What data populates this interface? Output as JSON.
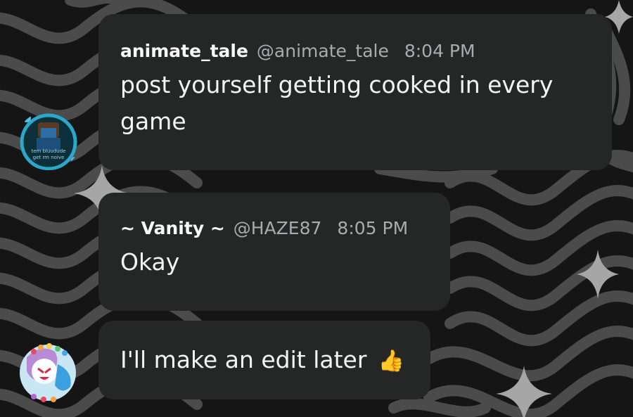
{
  "messages": [
    {
      "display_name": "animate_tale",
      "handle": "@animate_tale",
      "time": "8:04 PM",
      "text_line1": "post yourself getting cooked in every",
      "text_line2": "game",
      "avatar_caption1": "tem bluudude",
      "avatar_caption2": "get rm noive"
    },
    {
      "display_name": "~ Vanity ~",
      "handle": "@HAZE87",
      "time": "8:05 PM",
      "text": "Okay"
    },
    {
      "text": "I'll make an edit later",
      "emoji": "👍"
    }
  ],
  "colors": {
    "background": "#151515",
    "bubble": "#252727",
    "text": "#f4f4f4",
    "muted": "#a9abad",
    "avatar_ring": "#2aa7c9"
  },
  "icons": {
    "sparkle": "four-point-star",
    "thumbs_up": "thumbs-up-emoji"
  }
}
